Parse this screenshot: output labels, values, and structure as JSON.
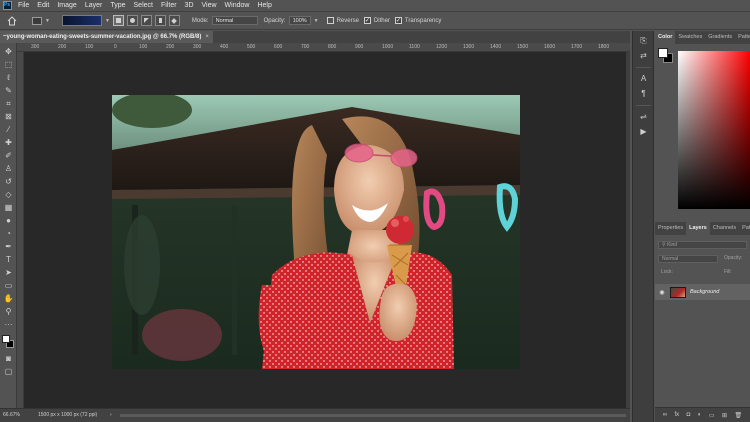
{
  "menu": {
    "logo": "Ps",
    "items": [
      "File",
      "Edit",
      "Image",
      "Layer",
      "Type",
      "Select",
      "Filter",
      "3D",
      "View",
      "Window",
      "Help"
    ]
  },
  "options": {
    "mode_label": "Mode:",
    "mode_value": "Normal",
    "opacity_label": "Opacity:",
    "opacity_value": "100%",
    "reverse_label": "Reverse",
    "dither_label": "Dither",
    "transparency_label": "Transparency",
    "reverse_checked": false,
    "dither_checked": true,
    "transparency_checked": true,
    "gradient_colors": [
      "#0a1430",
      "#1a2f6a"
    ]
  },
  "document": {
    "tab_title": "~young-woman-eating-sweets-summer-vacation.jpg @ 66.7% (RGB/8)",
    "close_glyph": "×"
  },
  "ruler": {
    "ticks": [
      "300",
      "200",
      "100",
      "0",
      "100",
      "200",
      "300",
      "400",
      "500",
      "600",
      "700",
      "800",
      "900",
      "1000",
      "1100",
      "1200",
      "1300",
      "1400",
      "1500",
      "1600",
      "1700",
      "1800"
    ]
  },
  "status": {
    "zoom": "66.67%",
    "doc_info": "1500 px x 1000 px (72 ppi)",
    "arrow": "›"
  },
  "panels": {
    "color_tabs": [
      "Color",
      "Swatches",
      "Gradients",
      "Patterns"
    ],
    "layer_tabs": [
      "Properties",
      "Layers",
      "Channels",
      "Paths"
    ],
    "kind_placeholder": "Kind",
    "blend_mode": "Normal",
    "opacity_short": "Opacity:",
    "lock_label": "Lock:",
    "fill_short": "Fill:",
    "layer_name": "Background",
    "foreground_color": "#ffffff",
    "background_color": "#000000"
  },
  "footer_icons": [
    "link-icon",
    "fx-icon",
    "mask-icon",
    "adjustment-icon",
    "folder-icon",
    "new-layer-icon",
    "trash-icon"
  ],
  "footer_glyphs": [
    "∞",
    "fx",
    "◘",
    "◐",
    "▭",
    "⊞",
    "🗑"
  ]
}
